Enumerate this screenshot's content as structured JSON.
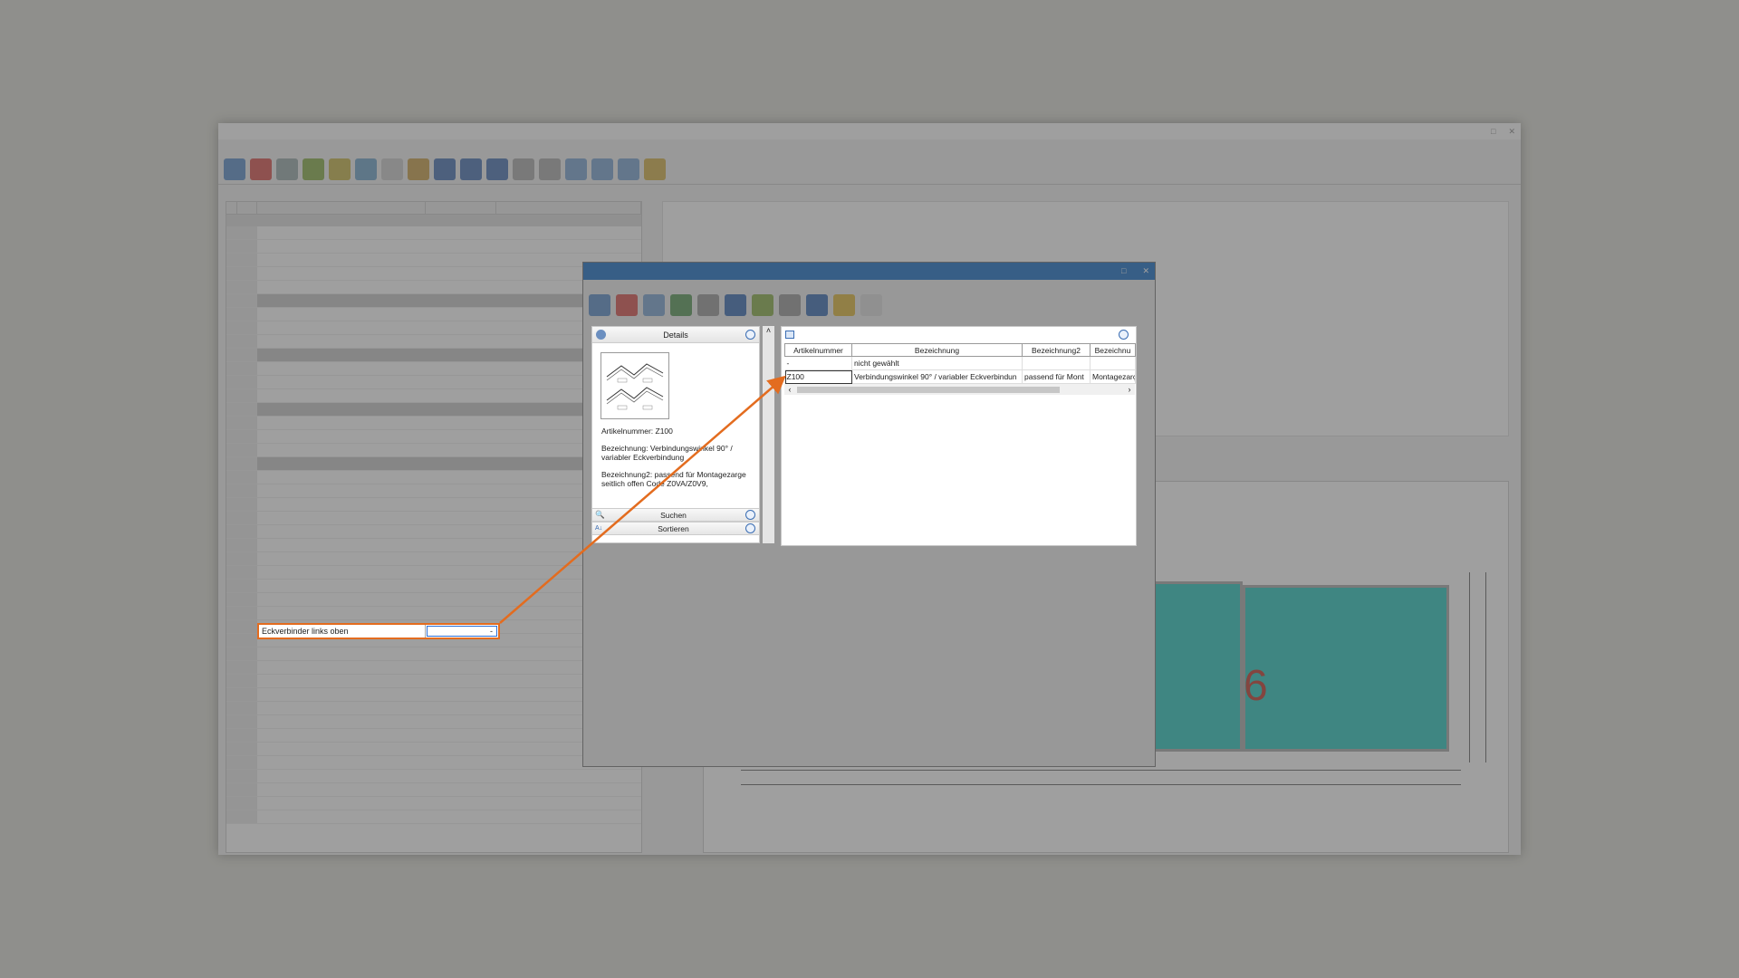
{
  "details": {
    "title": "Details",
    "artikelnummer": "Artikelnummer: Z100",
    "bezeichnung": "Bezeichnung: Verbindungswinkel 90° / variabler Eckverbindung",
    "bezeichnung2": "Bezeichnung2: passend für Montagezarge seitlich offen Code Z0VA/Z0V9,",
    "suchen": "Suchen",
    "sortieren": "Sortieren"
  },
  "grid": {
    "columns": [
      "Artikelnummer",
      "Bezeichnung",
      "Bezeichnung2",
      "Bezeichnu"
    ],
    "rows": [
      {
        "artikelnummer": "-",
        "bezeichnung": "nicht gewählt",
        "bezeichnung2": "",
        "bezeichnung3": ""
      },
      {
        "artikelnummer": "Z100",
        "bezeichnung": "Verbindungswinkel 90° / variabler Eckverbindun",
        "bezeichnung2": "passend für Mont",
        "bezeichnung3": "Montagezarç"
      }
    ],
    "scroll_left": "‹",
    "scroll_right": "›"
  },
  "highlight_row": {
    "label": "Eckverbinder links oben",
    "value": "-"
  },
  "drawing": {
    "pane_number": "6"
  },
  "colors": {
    "accent_orange": "#e36c1f",
    "dialog_titlebar": "#1a6fc8",
    "glass": "#2cc7bf"
  }
}
